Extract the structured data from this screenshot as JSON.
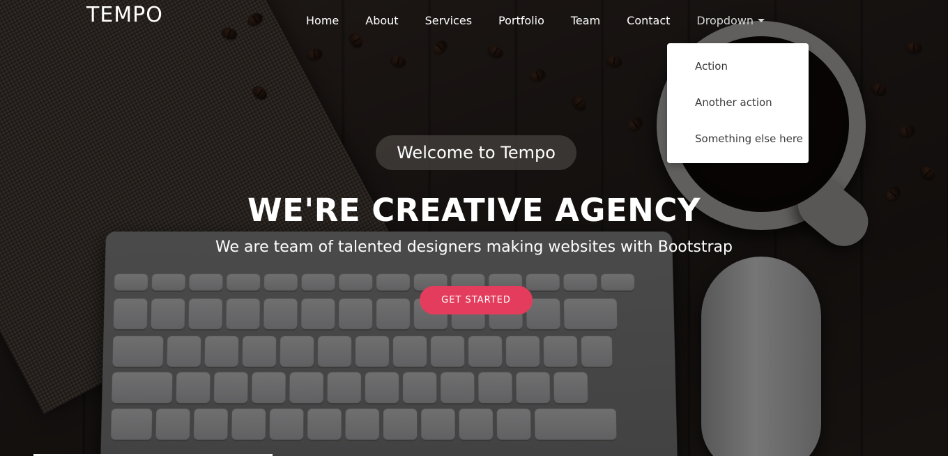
{
  "brand": {
    "name": "TEMPO"
  },
  "nav": {
    "items": [
      {
        "label": "Home"
      },
      {
        "label": "About"
      },
      {
        "label": "Services"
      },
      {
        "label": "Portfolio"
      },
      {
        "label": "Team"
      },
      {
        "label": "Contact"
      }
    ],
    "dropdown": {
      "label": "Dropdown",
      "items": [
        {
          "label": "Action"
        },
        {
          "label": "Another action"
        },
        {
          "label": "Something else here"
        }
      ]
    }
  },
  "hero": {
    "welcome": "Welcome to Tempo",
    "headline": "WE'RE CREATIVE AGENCY",
    "subtitle": "We are team of talented designers making websites with Bootstrap",
    "cta_label": "GET STARTED"
  },
  "colors": {
    "accent": "#e43c5c",
    "text": "#ffffff",
    "dropdown_bg": "#ffffff"
  }
}
